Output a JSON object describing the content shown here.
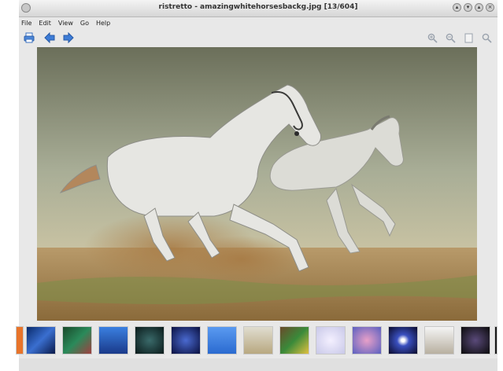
{
  "window": {
    "title": "ristretto - amazingwhitehorsesbackg.jpg [13/604]"
  },
  "menu": [
    {
      "label": "File"
    },
    {
      "label": "Edit"
    },
    {
      "label": "View"
    },
    {
      "label": "Go"
    },
    {
      "label": "Help"
    }
  ],
  "toolbar": {
    "left_icons": [
      "print-icon",
      "back-arrow-icon",
      "forward-arrow-icon"
    ],
    "right_icons": [
      "zoom-in-icon",
      "zoom-out-icon",
      "zoom-fit-icon",
      "zoom-100-icon"
    ]
  },
  "image": {
    "subject": "two white horses galloping"
  },
  "thumbnails": {
    "count_visible": 15,
    "colors": [
      "#e8742a",
      "#3a6fd0",
      "#2a8a5a",
      "#2b5fc0",
      "#1f3f3a",
      "#1d2f7a",
      "#3a7fe0",
      "#c9c2a8",
      "#5a8a3a",
      "#d8d8e8",
      "#a07fd0",
      "#0a1a3a",
      "#d0d0d0",
      "#3a2a4a",
      "#1a1a1a"
    ]
  }
}
